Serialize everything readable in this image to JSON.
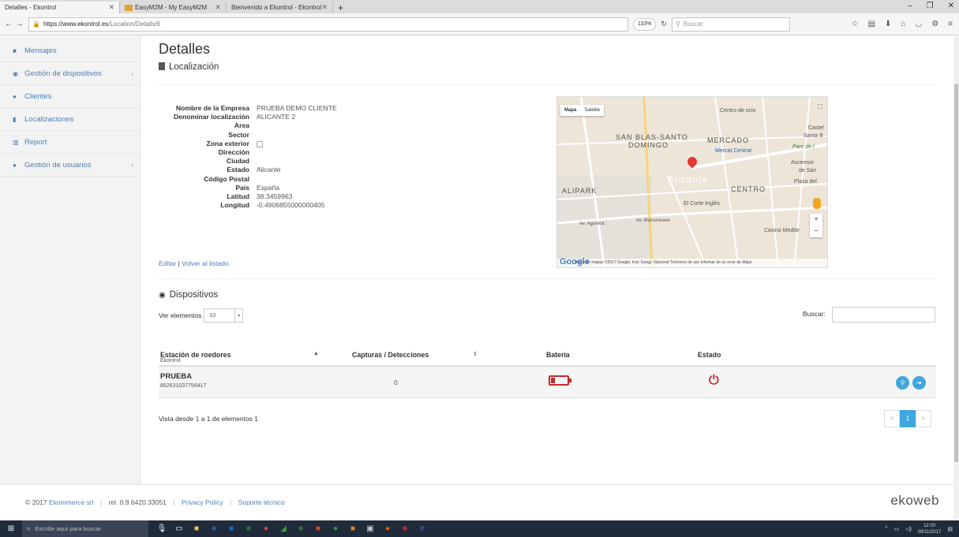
{
  "browser": {
    "tabs": [
      {
        "label": "Detalles - Ekontrol",
        "active": true
      },
      {
        "label": "EasyM2M - My EasyM2M",
        "active": false
      },
      {
        "label": "Bienvenido a Ekontrol - Ekontrol",
        "active": false
      }
    ],
    "url_host": "https://www.ekontrol.es",
    "url_path": "/Location/Details/6",
    "zoom": "110%",
    "search_placeholder": "Buscar"
  },
  "sidebar": {
    "items": [
      {
        "label": "Mensajes",
        "icon": "envelope-icon",
        "chevron": ""
      },
      {
        "label": "Gestión de dispositivos",
        "icon": "wifi-icon",
        "chevron": "‹"
      },
      {
        "label": "Clientes",
        "icon": "user-icon",
        "chevron": ""
      },
      {
        "label": "Localizaciones",
        "icon": "building-icon",
        "chevron": ""
      },
      {
        "label": "Report",
        "icon": "bar-chart-icon",
        "chevron": ""
      },
      {
        "label": "Gestión de usuarios",
        "icon": "users-icon",
        "chevron": "‹"
      }
    ]
  },
  "page": {
    "title": "Detalles",
    "subtitle": "Localización"
  },
  "details": [
    {
      "label": "Nombre de la Empresa",
      "value": "PRUEBA DEMO CLIENTE"
    },
    {
      "label": "Denominar localización",
      "value": "ALICANTE 2"
    },
    {
      "label": "Area",
      "value": ""
    },
    {
      "label": "Sector",
      "value": ""
    },
    {
      "label": "Zona exterior",
      "value": "",
      "checkbox": true
    },
    {
      "label": "Dirección",
      "value": ""
    },
    {
      "label": "Ciudad",
      "value": ""
    },
    {
      "label": "Estado",
      "value": "Alicante"
    },
    {
      "label": "Código Postal",
      "value": ""
    },
    {
      "label": "Pais",
      "value": "España"
    },
    {
      "label": "Latitud",
      "value": "38.3459963"
    },
    {
      "label": "Longitud",
      "value": "-0.4906855000000405"
    }
  ],
  "links": {
    "edit": "Editar",
    "separator": "|",
    "back": "Volver al listado"
  },
  "map": {
    "type_map": "Mapa",
    "type_satellite": "Satélite",
    "labels": [
      "SAN BLAS-SANTO",
      "DOMINGO",
      "MERCADO",
      "Alicante",
      "CENTRO",
      "ALIPARK",
      "Mercat Central",
      "Centro de ocio",
      "El Corte Inglés",
      "Casino Medite",
      "Av. Aguilera",
      "Av. Marsonnave",
      "Plaza del",
      "Castel",
      "Santa B",
      "Ascensor",
      "de San",
      "Parc de l"
    ],
    "footer": "Datos de mapas ©2017 Google, Inst. Geogr. Nacional   Términos de uso   Informar de un error de Maps",
    "google": "Google"
  },
  "devices": {
    "title": "Dispositivos",
    "show_label": "Ver elementos",
    "show_value": "10",
    "search_label": "Buscar:",
    "columns": {
      "station": "Estación de roedores",
      "station_sub": "Ekontrol",
      "captures": "Capturas / Detecciones",
      "battery": "Bateria",
      "state": "Estado"
    },
    "rows": [
      {
        "name": "PRUEBA",
        "id": "862631037756417",
        "captures": "0"
      }
    ],
    "info": "Vista desde 1 a 1 de elementos 1",
    "pager": {
      "prev": "<",
      "current": "1",
      "next": ">"
    }
  },
  "footer": {
    "copyright": "© 2017",
    "company": "Ekommerce srl",
    "release": "rel. 0.9.6420.33051",
    "privacy": "Privacy Policy",
    "support": "Soporte técnico",
    "logo": "ekoweb"
  },
  "taskbar": {
    "search_placeholder": "Escribe aquí para buscar",
    "time": "12:00",
    "date": "09/11/2017"
  }
}
